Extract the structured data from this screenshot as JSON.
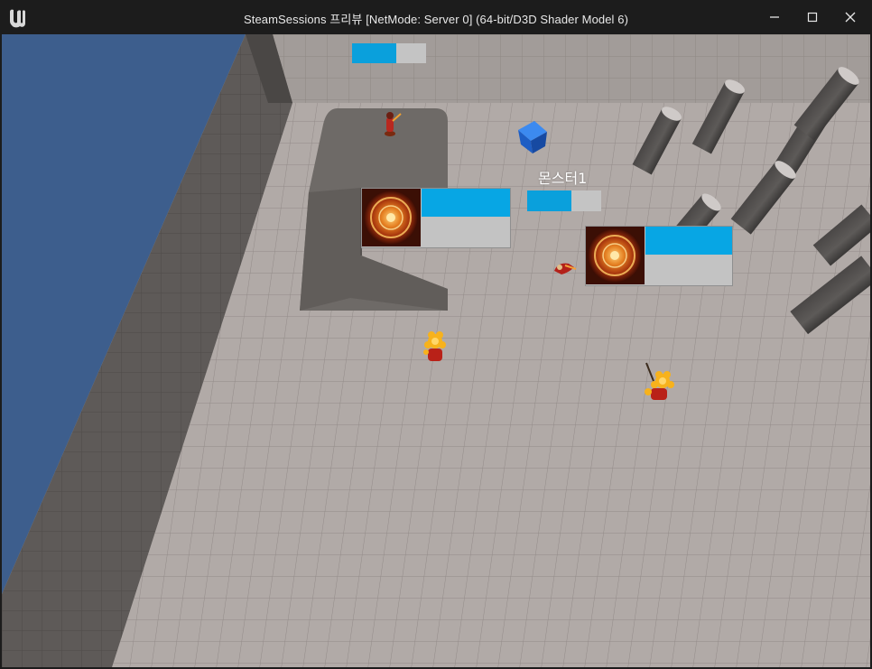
{
  "window": {
    "title": "SteamSessions 프리뷰 [NetMode: Server 0]  (64-bit/D3D Shader Model 6)",
    "app_icon": "unreal-engine-logo",
    "controls": [
      "minimize-icon",
      "maximize-icon",
      "close-icon"
    ]
  },
  "hud": {
    "monster_label": "몬스터1",
    "monster_health": 0.6,
    "top_partial_health": 0.6,
    "player_panels": [
      {
        "portrait": "ornate-orange-medallion",
        "health": 1.0,
        "mana": 0.0
      },
      {
        "portrait": "ornate-orange-medallion",
        "health": 1.0,
        "mana": 0.0
      }
    ]
  },
  "colors": {
    "health_fill": "#07a6e4",
    "bar_background": "#c3c3c3",
    "water": "#3e5f8e",
    "floor": "#b0a9a6",
    "wall": "#5c5856",
    "cube": "#1f6ad3"
  }
}
